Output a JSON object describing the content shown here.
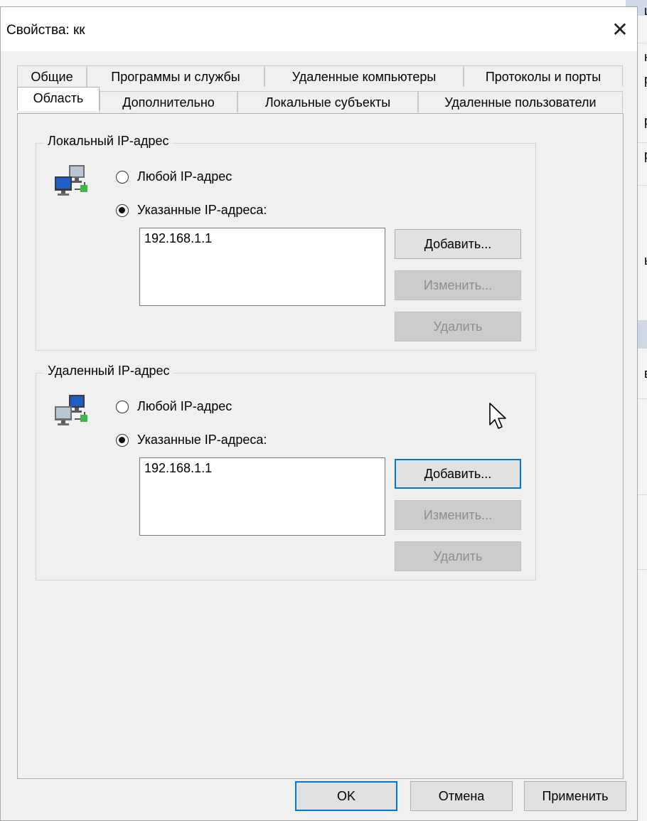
{
  "window": {
    "title": "Свойства: кк",
    "close_glyph": "✕"
  },
  "background_chars": [
    "ц",
    "ю",
    "р",
    "р",
    "р",
    "ь",
    "в"
  ],
  "tabs_row1": [
    {
      "label": "Общие"
    },
    {
      "label": "Программы и службы"
    },
    {
      "label": "Удаленные компьютеры"
    },
    {
      "label": "Протоколы и порты"
    }
  ],
  "tabs_row2": [
    {
      "label": "Область",
      "active": true
    },
    {
      "label": "Дополнительно"
    },
    {
      "label": "Локальные субъекты"
    },
    {
      "label": "Удаленные пользователи"
    }
  ],
  "local": {
    "legend": "Локальный IP-адрес",
    "icon": "network-computers-icon",
    "any_label": "Любой IP-адрес",
    "specified_label": "Указанные IP-адреса:",
    "selected": "specified",
    "addresses": [
      "192.168.1.1"
    ],
    "add_label": "Добавить...",
    "edit_label": "Изменить...",
    "remove_label": "Удалить"
  },
  "remote": {
    "legend": "Удаленный IP-адрес",
    "icon": "network-computers-icon",
    "any_label": "Любой IP-адрес",
    "specified_label": "Указанные IP-адреса:",
    "selected": "specified",
    "addresses": [
      "192.168.1.1"
    ],
    "add_label": "Добавить...",
    "edit_label": "Изменить...",
    "remove_label": "Удалить"
  },
  "footer": {
    "ok_label": "OK",
    "cancel_label": "Отмена",
    "apply_label": "Применить"
  },
  "colors": {
    "focus": "#0078d7",
    "dialog_bg": "#f0f0f0",
    "disabled_text": "#8d8d8d"
  }
}
